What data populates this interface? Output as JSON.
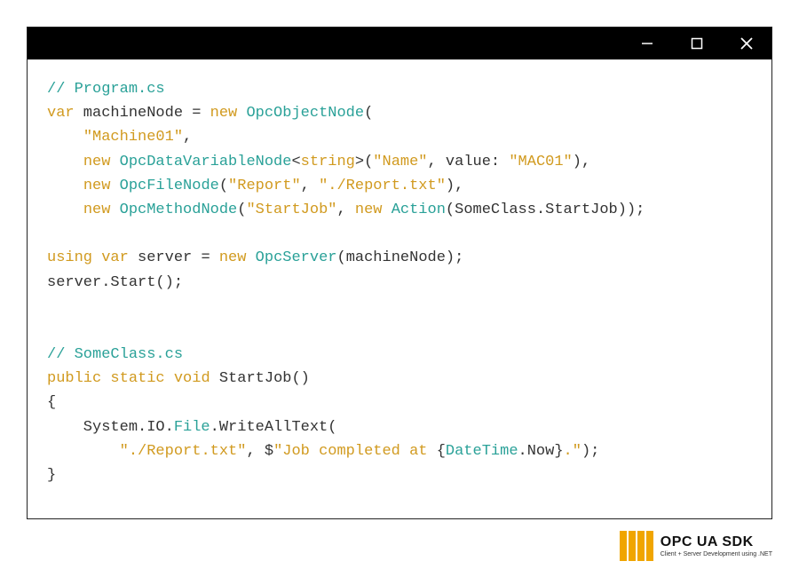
{
  "code": {
    "l1_comment": "// Program.cs",
    "l2_var": "var",
    "l2_machineNode": " machineNode = ",
    "l2_new": "new",
    "l2_type": " OpcObjectNode",
    "l2_paren": "(",
    "l3_string": "\"Machine01\"",
    "l3_comma": ",",
    "l4_new": "new",
    "l4_type": " OpcDataVariableNode",
    "l4_lt": "<",
    "l4_string_kw": "string",
    "l4_gt": ">(",
    "l4_name": "\"Name\"",
    "l4_mid": ", value: ",
    "l4_mac": "\"MAC01\"",
    "l4_end": "),",
    "l5_new": "new",
    "l5_type": " OpcFileNode",
    "l5_open": "(",
    "l5_report": "\"Report\"",
    "l5_comma": ", ",
    "l5_path": "\"./Report.txt\"",
    "l5_end": "),",
    "l6_new": "new",
    "l6_type": " OpcMethodNode",
    "l6_open": "(",
    "l6_startjob": "\"StartJob\"",
    "l6_comma": ", ",
    "l6_new2": "new",
    "l6_action": " Action",
    "l6_open2": "(SomeClass.StartJob));",
    "l8_using": "using",
    "l8_var": " var",
    "l8_server": " server = ",
    "l8_new": "new",
    "l8_type": " OpcServer",
    "l8_end": "(machineNode);",
    "l9": "server.Start();",
    "l12_comment": "// SomeClass.cs",
    "l13_public": "public",
    "l13_static": " static",
    "l13_void": " void",
    "l13_name": " StartJob()",
    "l14": "{",
    "l15_pre": "    System.IO.",
    "l15_file": "File",
    "l15_post": ".WriteAllText(",
    "l16_pre": "        ",
    "l16_path": "\"./Report.txt\"",
    "l16_mid": ", $",
    "l16_s1": "\"Job completed at ",
    "l16_brace_open": "{",
    "l16_dt": "DateTime",
    "l16_now": ".Now",
    "l16_brace_close": "}",
    "l16_s2": ".\"",
    "l16_end": ");",
    "l17": "}"
  },
  "logo": {
    "main": "OPC UA",
    "sdk": " SDK",
    "sub": "Client + Server Development using .NET"
  }
}
